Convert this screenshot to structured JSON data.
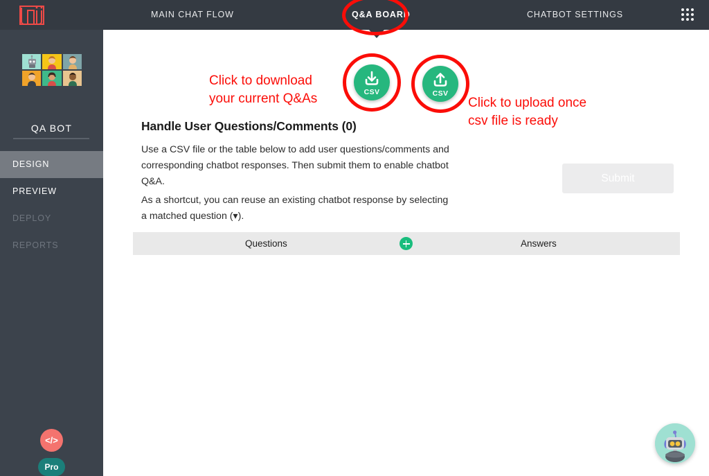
{
  "app": {
    "logo_text": "Juji",
    "logo_color": "#ef4a47"
  },
  "topnav": {
    "items": [
      {
        "label": "MAIN CHAT FLOW",
        "active": false
      },
      {
        "label": "Q&A BOARD",
        "active": true
      },
      {
        "label": "CHATBOT SETTINGS",
        "active": false
      }
    ],
    "apps_grid_icon": "grid-3x3-icon"
  },
  "sidebar": {
    "bot_name": "QA BOT",
    "avatar_tiles": [
      {
        "name": "robot-avatar",
        "bg": "#9fe0d2"
      },
      {
        "name": "woman-avatar-1",
        "bg": "#f5c518"
      },
      {
        "name": "person-avatar-1",
        "bg": "#7fa5a8"
      },
      {
        "name": "person-avatar-2",
        "bg": "#f0a32a"
      },
      {
        "name": "woman-avatar-2",
        "bg": "#3fb98a"
      },
      {
        "name": "person-avatar-3",
        "bg": "#e8c48f"
      }
    ],
    "items": [
      {
        "label": "DESIGN",
        "state": "active"
      },
      {
        "label": "PREVIEW",
        "state": "enabled"
      },
      {
        "label": "DEPLOY",
        "state": "disabled"
      },
      {
        "label": "REPORTS",
        "state": "disabled"
      }
    ],
    "code_button_label": "</>",
    "pro_badge_label": "Pro"
  },
  "main": {
    "title": "Handle User Questions/Comments (0)",
    "paragraph_1": "Use a CSV file or the table below to add user questions/comments and corresponding chatbot responses. Then submit them to enable chatbot Q&A.",
    "paragraph_2": "As a shortcut, you can reuse an existing chatbot response by selecting a matched question (▾).",
    "submit_label": "Submit",
    "submit_enabled": false
  },
  "csv_buttons": {
    "download": {
      "label": "CSV",
      "icon": "download-icon"
    },
    "upload": {
      "label": "CSV",
      "icon": "upload-icon"
    }
  },
  "annotations": {
    "color": "#fb0d08",
    "download_note": "Click to download\nyour current Q&As",
    "upload_note": "Click to upload once\ncsv file is ready"
  },
  "table": {
    "columns": [
      {
        "label": "Questions"
      },
      {
        "label": "Answers"
      }
    ],
    "add_row_icon": "plus-icon",
    "rows": []
  },
  "bot_fab": {
    "icon": "robot-avatar-icon",
    "bg": "#9fe0d2"
  },
  "colors": {
    "nav_bg": "#343a42",
    "sidebar_bg": "#3c434c",
    "sidebar_active": "#767b82",
    "green": "#26b77e",
    "annotation_red": "#fb0d08",
    "table_header_bg": "#e9e9e9"
  }
}
